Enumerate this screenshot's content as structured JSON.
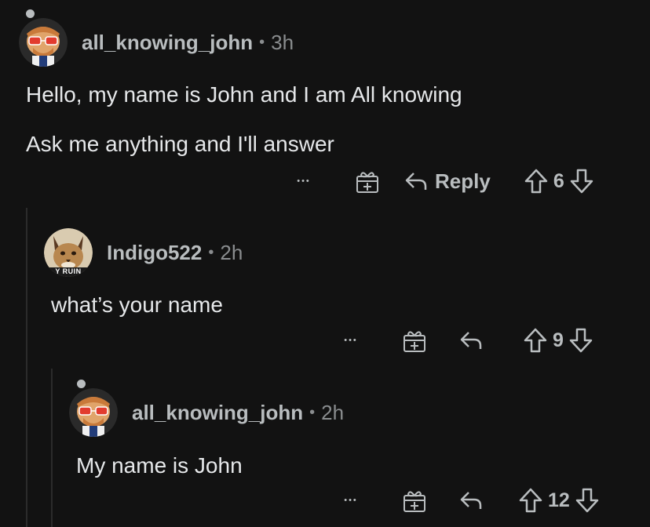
{
  "comments": [
    {
      "username": "all_knowing_john",
      "time": "3h",
      "lines": [
        "Hello, my name is John and I am All knowing",
        "Ask me anything and I'll answer"
      ],
      "reply_label": "Reply",
      "votes": "6",
      "more": "•••"
    },
    {
      "username": "Indigo522",
      "time": "2h",
      "avatar_caption": "Y RUIN",
      "lines": [
        "what’s your name"
      ],
      "votes": "9",
      "more": "•••"
    },
    {
      "username": "all_knowing_john",
      "time": "2h",
      "lines": [
        "My name is John"
      ],
      "votes": "12",
      "more": "•••"
    }
  ],
  "separator": "•",
  "colors": {
    "background": "#121212",
    "text": "#e6e8ea",
    "muted": "#8a8d8f",
    "thread_line": "#2b2b2b"
  },
  "icons": [
    "more-icon",
    "award-icon",
    "reply-arrow-icon",
    "upvote-icon",
    "downvote-icon"
  ]
}
